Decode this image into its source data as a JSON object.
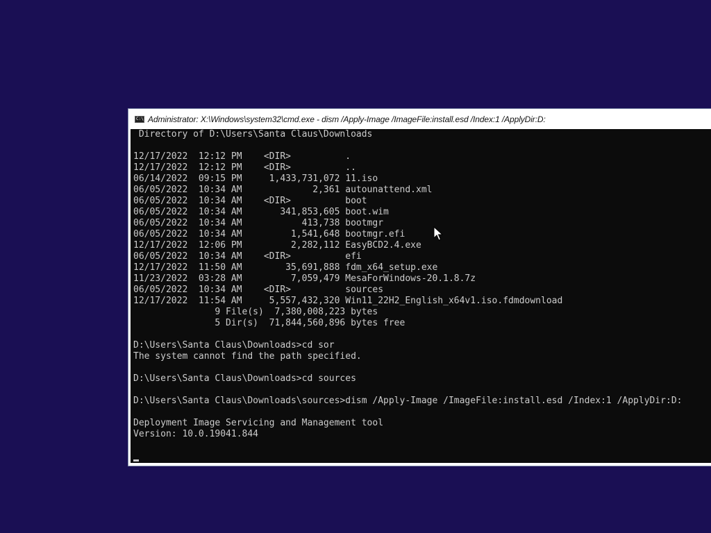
{
  "window": {
    "title": "Administrator: X:\\Windows\\system32\\cmd.exe - dism  /Apply-Image /ImageFile:install.esd /Index:1 /ApplyDir:D:",
    "icon": "cmd-icon",
    "icon_text": "C:\\"
  },
  "console": {
    "lines": [
      " Directory of D:\\Users\\Santa Claus\\Downloads",
      "",
      "12/17/2022  12:12 PM    <DIR>          .",
      "12/17/2022  12:12 PM    <DIR>          ..",
      "06/14/2022  09:15 PM     1,433,731,072 11.iso",
      "06/05/2022  10:34 AM             2,361 autounattend.xml",
      "06/05/2022  10:34 AM    <DIR>          boot",
      "06/05/2022  10:34 AM       341,853,605 boot.wim",
      "06/05/2022  10:34 AM           413,738 bootmgr",
      "06/05/2022  10:34 AM         1,541,648 bootmgr.efi",
      "12/17/2022  12:06 PM         2,282,112 EasyBCD2.4.exe",
      "06/05/2022  10:34 AM    <DIR>          efi",
      "12/17/2022  11:50 AM        35,691,888 fdm_x64_setup.exe",
      "11/23/2022  03:28 AM         7,059,479 MesaForWindows-20.1.8.7z",
      "06/05/2022  10:34 AM    <DIR>          sources",
      "12/17/2022  11:54 AM     5,557,432,320 Win11_22H2_English_x64v1.iso.fdmdownload",
      "               9 File(s)  7,380,008,223 bytes",
      "               5 Dir(s)  71,844,560,896 bytes free",
      "",
      "D:\\Users\\Santa Claus\\Downloads>cd sor",
      "The system cannot find the path specified.",
      "",
      "D:\\Users\\Santa Claus\\Downloads>cd sources",
      "",
      "D:\\Users\\Santa Claus\\Downloads\\sources>dism /Apply-Image /ImageFile:install.esd /Index:1 /ApplyDir:D:",
      "",
      "Deployment Image Servicing and Management tool",
      "Version: 10.0.19041.844"
    ]
  },
  "colors": {
    "desktop": "#1a0f54",
    "console_bg": "#0c0c0c",
    "console_fg": "#cccccc"
  }
}
